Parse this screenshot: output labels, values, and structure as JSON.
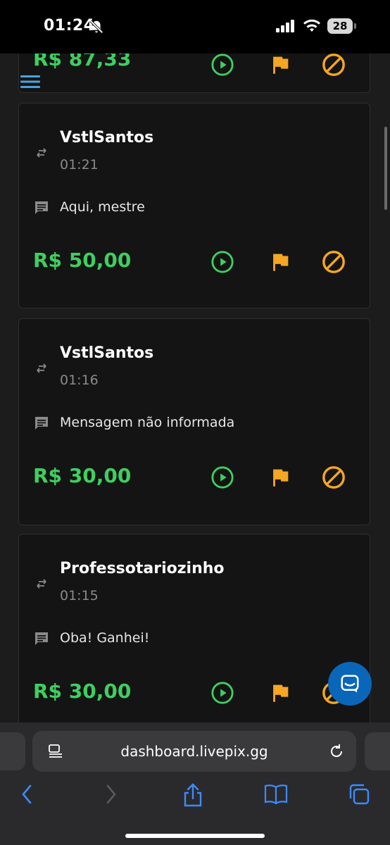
{
  "status_bar": {
    "time": "01:24",
    "battery": "28"
  },
  "top_card": {
    "amount": "R$ 87,33"
  },
  "donations": [
    {
      "username": "VstlSantos",
      "time": "01:21",
      "message": "Aqui, mestre",
      "amount": "R$ 50,00"
    },
    {
      "username": "VstlSantos",
      "time": "01:16",
      "message": "Mensagem não informada",
      "amount": "R$ 30,00"
    },
    {
      "username": "Professotariozinho",
      "time": "01:15",
      "message": "Oba! Ganhei!",
      "amount": "R$ 30,00"
    }
  ],
  "browser": {
    "url": "dashboard.livepix.gg"
  },
  "colors": {
    "amount": "#3ecf60",
    "play": "#3ecf60",
    "flag": "#f5a623",
    "block": "#f5a623",
    "menu": "#4aa3df",
    "chat": "#0a66b8"
  },
  "icons": {
    "transaction": "swap-arrows-icon",
    "message": "chat-bubble-icon",
    "play": "play-circle-icon",
    "flag": "flag-icon",
    "block": "block-icon"
  }
}
